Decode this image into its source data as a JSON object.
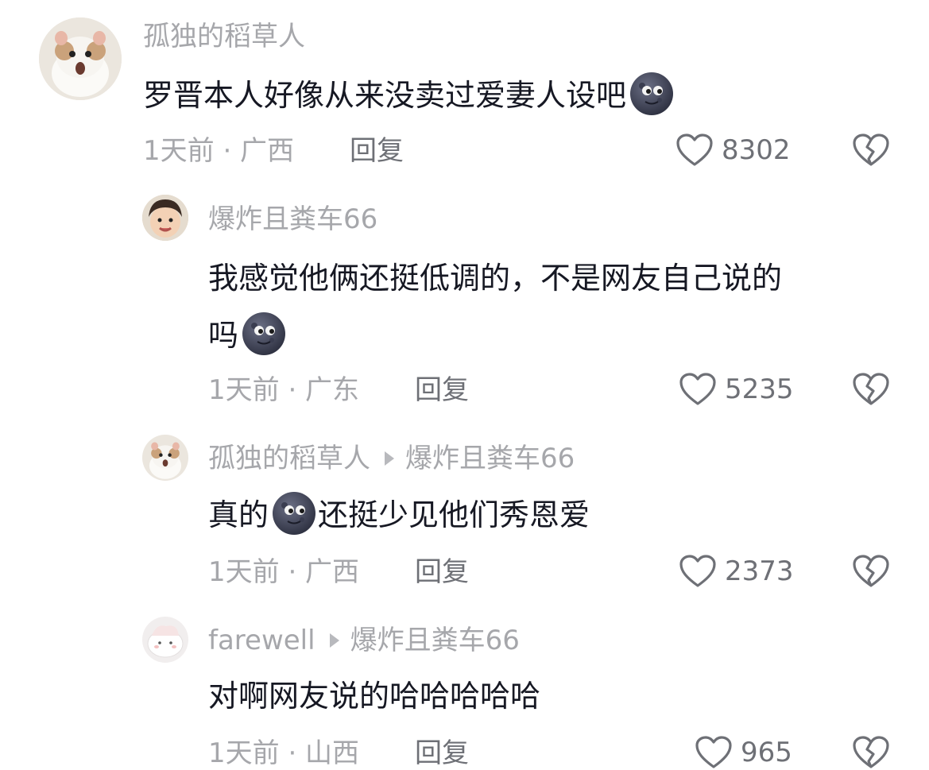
{
  "comments": [
    {
      "username": "孤独的稻草人",
      "reply_to": "",
      "text_parts": [
        "罗晋本人好像从来没卖过爱妻人设吧",
        ""
      ],
      "emoji": "new-moon-face-emoji",
      "time_location": "1天前 · 广西",
      "reply_label": "回复",
      "likes": "8302"
    },
    {
      "username": "爆炸且粪车66",
      "reply_to": "",
      "text_line1": "我感觉他俩还挺低调的，不是网友自己说的",
      "text_line2": "吗",
      "emoji": "new-moon-face-emoji",
      "time_location": "1天前 · 广东",
      "reply_label": "回复",
      "likes": "5235"
    },
    {
      "username": "孤独的稻草人",
      "reply_to": "爆炸且粪车66",
      "text_before": "真的",
      "text_after": "还挺少见他们秀恩爱",
      "emoji": "new-moon-face-emoji",
      "time_location": "1天前 · 广西",
      "reply_label": "回复",
      "likes": "2373"
    },
    {
      "username": "farewell",
      "reply_to": "爆炸且粪车66",
      "text": "对啊网友说的哈哈哈哈哈",
      "time_location": "1天前 · 山西",
      "reply_label": "回复",
      "likes": "965"
    }
  ],
  "colors": {
    "text": "#161823",
    "secondary": "#a6a7ab",
    "reply": "#6e7076"
  },
  "icons": [
    "heart-outline-icon",
    "broken-heart-icon",
    "triangle-arrow-icon"
  ]
}
